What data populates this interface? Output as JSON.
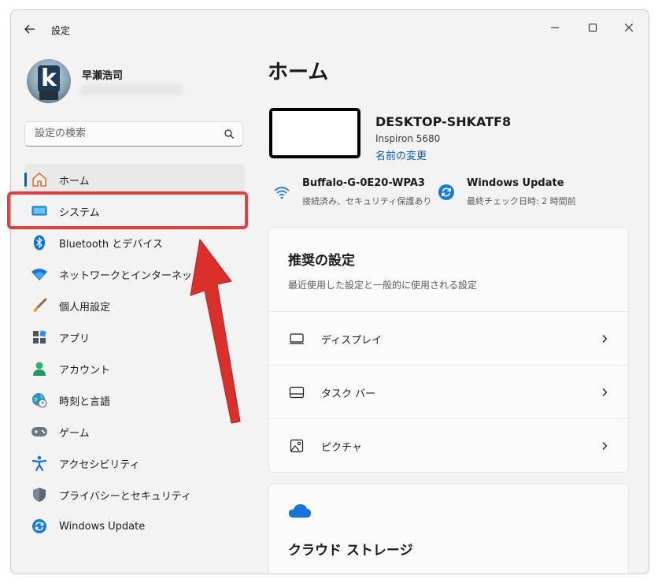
{
  "window": {
    "title": "設定"
  },
  "user": {
    "name": "早瀬浩司"
  },
  "search": {
    "placeholder": "設定の検索"
  },
  "nav": [
    {
      "label": "ホーム",
      "icon": "home-icon"
    },
    {
      "label": "システム",
      "icon": "system-icon"
    },
    {
      "label": "Bluetooth とデバイス",
      "icon": "bluetooth-icon"
    },
    {
      "label": "ネットワークとインターネット",
      "icon": "wifi-icon"
    },
    {
      "label": "個人用設定",
      "icon": "brush-icon"
    },
    {
      "label": "アプリ",
      "icon": "apps-icon"
    },
    {
      "label": "アカウント",
      "icon": "account-icon"
    },
    {
      "label": "時刻と言語",
      "icon": "globe-clock-icon"
    },
    {
      "label": "ゲーム",
      "icon": "gamepad-icon"
    },
    {
      "label": "アクセシビリティ",
      "icon": "accessibility-icon"
    },
    {
      "label": "プライバシーとセキュリティ",
      "icon": "shield-icon"
    },
    {
      "label": "Windows Update",
      "icon": "update-icon"
    }
  ],
  "main": {
    "title": "ホーム",
    "device": {
      "name": "DESKTOP-SHKATF8",
      "model": "Inspiron 5680",
      "rename": "名前の変更"
    },
    "network": {
      "title": "Buffalo-G-0E20-WPA3",
      "sub": "接続済み、セキュリティ保護あり"
    },
    "update": {
      "title": "Windows Update",
      "sub": "最終チェック日時: 2 時間前"
    },
    "recommended": {
      "title": "推奨の設定",
      "subtitle": "最近使用した設定と一般的に使用される設定",
      "items": [
        {
          "label": "ディスプレイ",
          "icon": "display-icon"
        },
        {
          "label": "タスク バー",
          "icon": "taskbar-icon"
        },
        {
          "label": "ピクチャ",
          "icon": "picture-icon"
        }
      ]
    },
    "cloud": {
      "title": "クラウド ストレージ"
    }
  },
  "colors": {
    "accent": "#005fb8",
    "highlight": "#e0413c",
    "arrow": "#d9302c"
  }
}
